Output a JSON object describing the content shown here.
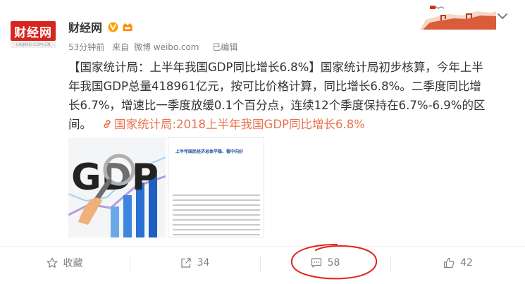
{
  "author": {
    "name": "财经网",
    "avatar_text": "财经网",
    "avatar_sub": "CAIJING.COM.CN"
  },
  "meta": {
    "time": "53分钟前",
    "from_label": "来自",
    "source": "微博 weibo.com",
    "edited": "已编辑"
  },
  "post": {
    "lines": [
      "【国家统计局：上半年我国GDP同比增长6.8%】国家统计局初步核算，今年上半",
      "年我国GDP总量418961亿元，按可比价格计算，同比增长6.8%。二季度同比增",
      "长6.7%，增速比一季度放缓0.1个百分点，连续12个季度保持在6.7%-6.9%的区"
    ],
    "last_line_text": "间。",
    "link_text": "国家统计局:2018上半年我国GDP同比增长6.8%"
  },
  "images": {
    "pic1_text": "GDP",
    "doc_title": "上半年国民经济总体平稳、稳中向好"
  },
  "actions": {
    "favorite_label": "收藏",
    "forward_count": "34",
    "comment_count": "58",
    "like_count": "42"
  },
  "colors": {
    "link": "#eb7350",
    "verified": "#ffa00a",
    "brand_red": "#d7251f",
    "annotation": "#e2231a"
  },
  "icons": {
    "verified": "verified-icon",
    "vip": "vip-badge-icon",
    "chevron": "chevron-down-icon",
    "link": "link-icon",
    "favorite": "star-icon",
    "forward": "forward-icon",
    "comment": "comment-icon",
    "like": "thumbs-up-icon"
  }
}
